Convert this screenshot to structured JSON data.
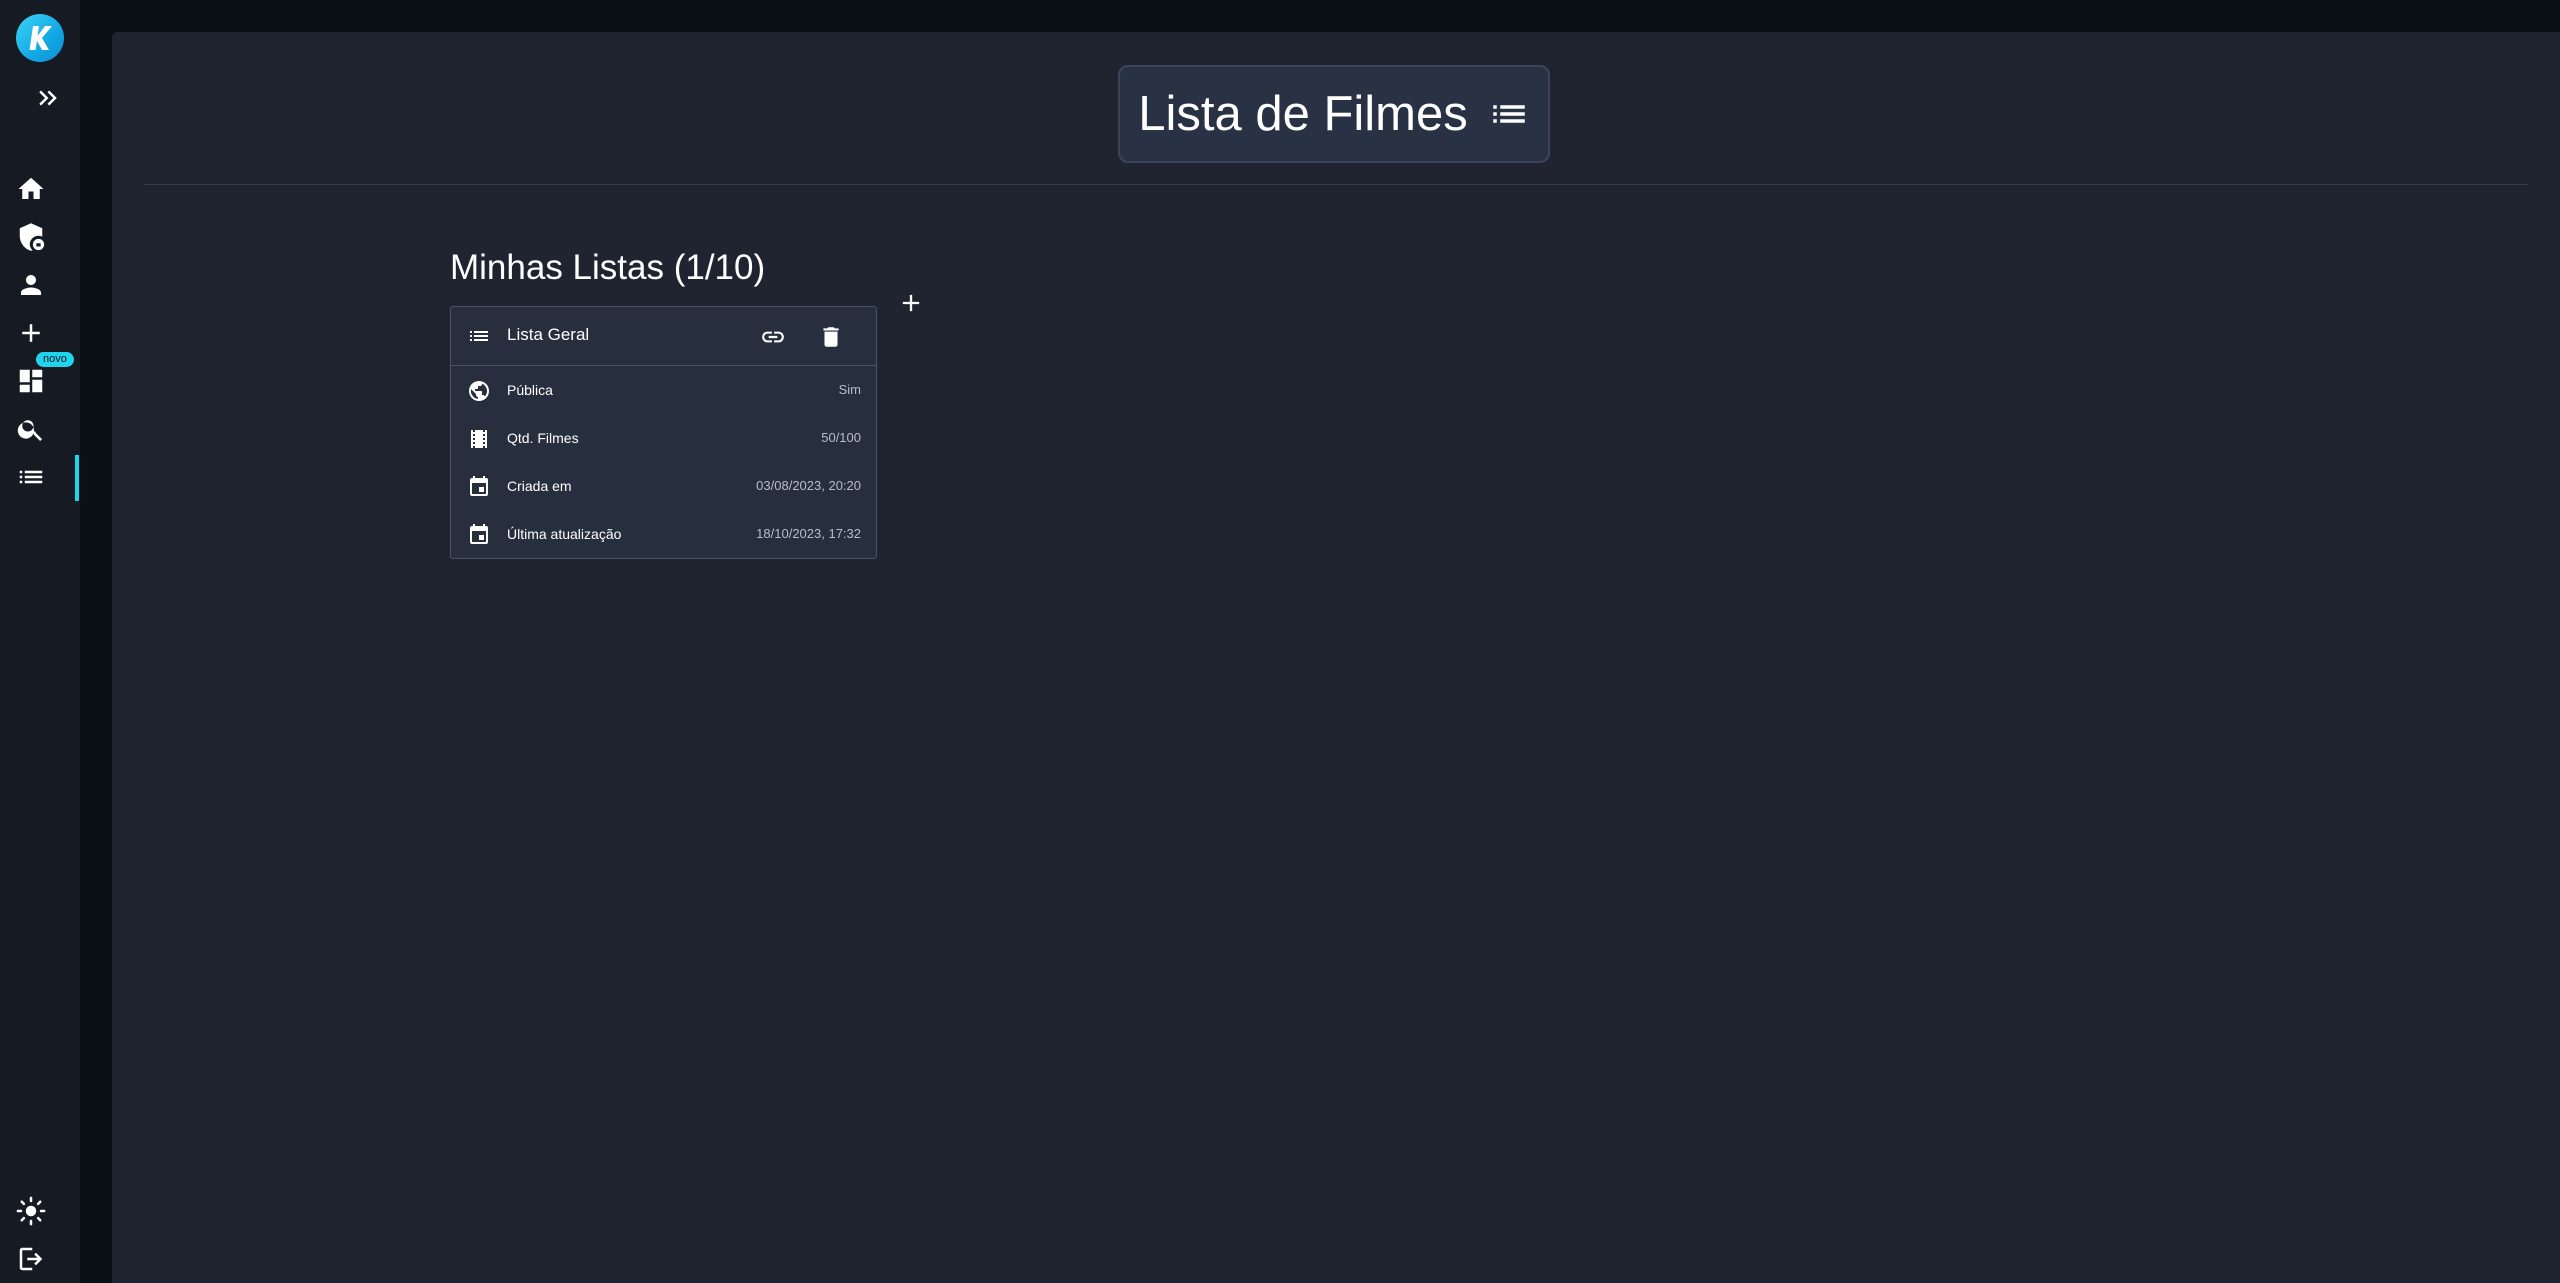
{
  "page": {
    "title": "Lista de Filmes"
  },
  "sidebar": {
    "logo_letter": "K",
    "badge": "novo",
    "items": [
      {
        "name": "home-icon"
      },
      {
        "name": "shield-lock-icon"
      },
      {
        "name": "person-icon"
      },
      {
        "name": "plus-icon"
      },
      {
        "name": "dashboard-icon"
      },
      {
        "name": "search-icon"
      },
      {
        "name": "list-icon",
        "active": true
      }
    ],
    "bottom": [
      {
        "name": "sun-icon"
      },
      {
        "name": "logout-icon"
      }
    ]
  },
  "lists": {
    "heading": "Minhas Listas (1/10)",
    "cards": [
      {
        "title": "Lista Geral",
        "rows": [
          {
            "icon": "globe-icon",
            "label": "Pública",
            "value": "Sim"
          },
          {
            "icon": "film-icon",
            "label": "Qtd. Filmes",
            "value": "50/100"
          },
          {
            "icon": "calendar-icon",
            "label": "Criada em",
            "value": "03/08/2023, 20:20"
          },
          {
            "icon": "calendar-icon",
            "label": "Última atualização",
            "value": "18/10/2023, 17:32"
          }
        ]
      }
    ]
  },
  "colors": {
    "accent": "#22d3ee",
    "sidebar_bg": "#151a23",
    "main_bg": "#1f2430",
    "card_bg": "#272f3f"
  }
}
